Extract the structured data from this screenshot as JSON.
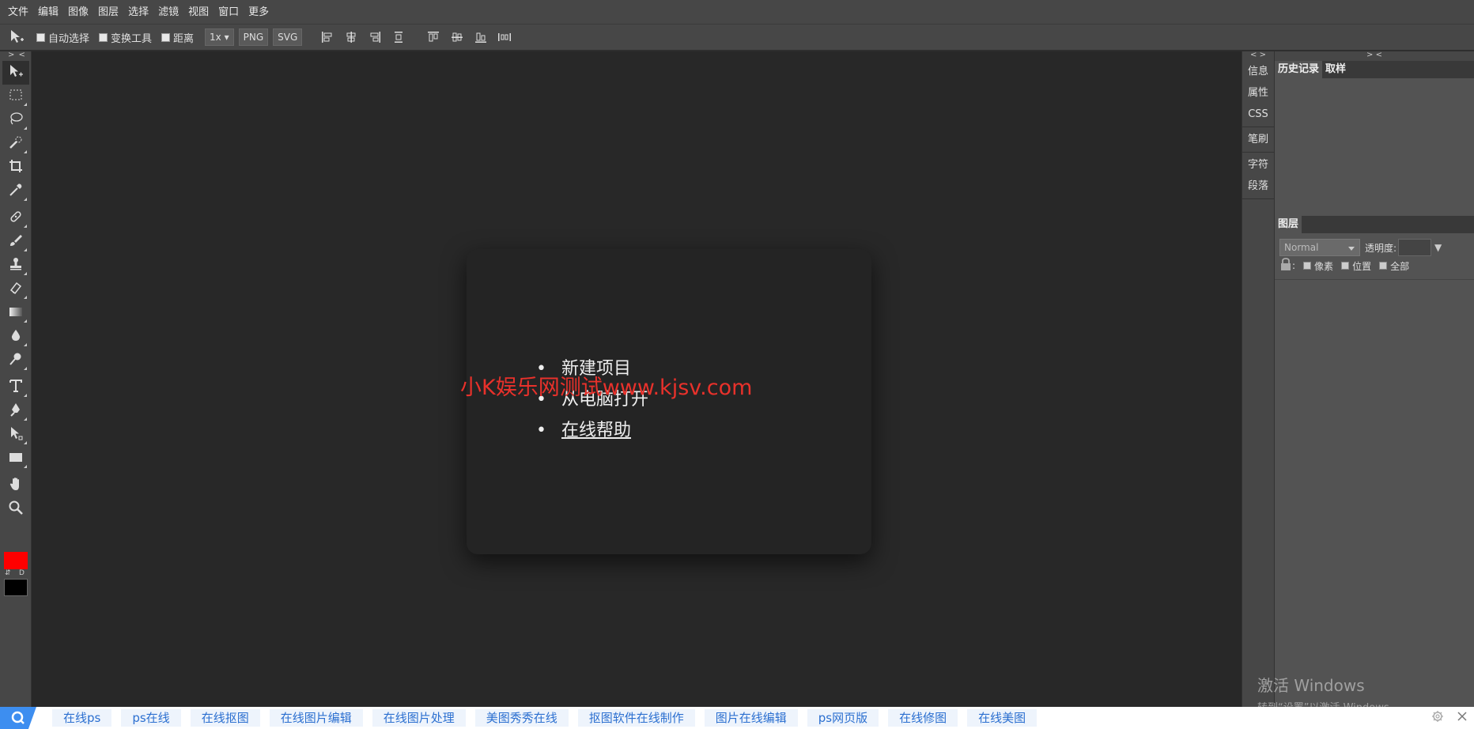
{
  "menu": [
    "文件",
    "编辑",
    "图像",
    "图层",
    "选择",
    "滤镜",
    "视图",
    "窗口",
    "更多"
  ],
  "options": {
    "auto_select": "自动选择",
    "transform": "变换工具",
    "distance": "距离",
    "zoom": "1x",
    "png": "PNG",
    "svg": "SVG"
  },
  "toolbar": {
    "collapse": "> <",
    "swap_label": "⇵",
    "default_label": "D",
    "foreground_color": "#ff0000",
    "background_color": "#000000"
  },
  "canvas": {
    "menu_items": [
      "新建项目",
      "从电脑打开",
      "在线帮助"
    ],
    "watermark": "小K娱乐网测试www.kjsv.com"
  },
  "dock": {
    "collapse": "< >",
    "items": [
      "信息",
      "属性",
      "CSS",
      "笔刷",
      "字符",
      "段落"
    ]
  },
  "panels": {
    "collapse": "> <",
    "history_tabs": [
      "历史记录",
      "取样"
    ],
    "layers_tab": "图层",
    "blend_mode": "Normal",
    "opacity_label": "透明度:",
    "lock_options": [
      "像素",
      "位置",
      "全部"
    ]
  },
  "activation": {
    "line1": "激活 Windows",
    "line2": "转到“设置”以激活 Windows。"
  },
  "linkbar": {
    "links": [
      "在线ps",
      "ps在线",
      "在线抠图",
      "在线图片编辑",
      "在线图片处理",
      "美图秀秀在线",
      "抠图软件在线制作",
      "图片在线编辑",
      "ps网页版",
      "在线修图",
      "在线美图"
    ]
  }
}
